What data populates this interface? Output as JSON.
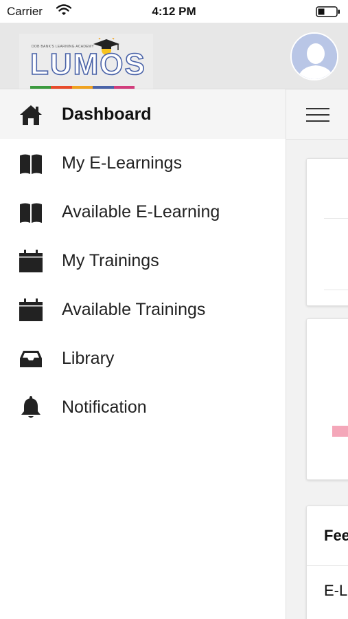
{
  "status_bar": {
    "carrier": "Carrier",
    "time": "4:12 PM"
  },
  "header": {
    "logo": {
      "subtitle": "DOB BANK'S LEARNING ACADEMY",
      "brand": "LUMOS",
      "bar_colors": [
        "#3b9a3e",
        "#e84b2a",
        "#f0a21f",
        "#4a63a8",
        "#d23d7c"
      ]
    }
  },
  "drawer": {
    "items": [
      {
        "label": "Dashboard",
        "icon": "home-icon",
        "active": true
      },
      {
        "label": "My E-Learnings",
        "icon": "book-icon",
        "active": false
      },
      {
        "label": "Available E-Learning",
        "icon": "book-icon",
        "active": false
      },
      {
        "label": "My Trainings",
        "icon": "calendar-icon",
        "active": false
      },
      {
        "label": "Available Trainings",
        "icon": "calendar-icon",
        "active": false
      },
      {
        "label": "Library",
        "icon": "inbox-icon",
        "active": false
      },
      {
        "label": "Notification",
        "icon": "bell-icon",
        "active": false
      }
    ]
  },
  "content": {
    "feed_card": {
      "title": "Fee",
      "first_item": "E-L"
    }
  },
  "colors": {
    "accent_pink": "#f4a7b9",
    "logo_blue": "#4a63a8",
    "header_bg": "#e7e7e7"
  }
}
